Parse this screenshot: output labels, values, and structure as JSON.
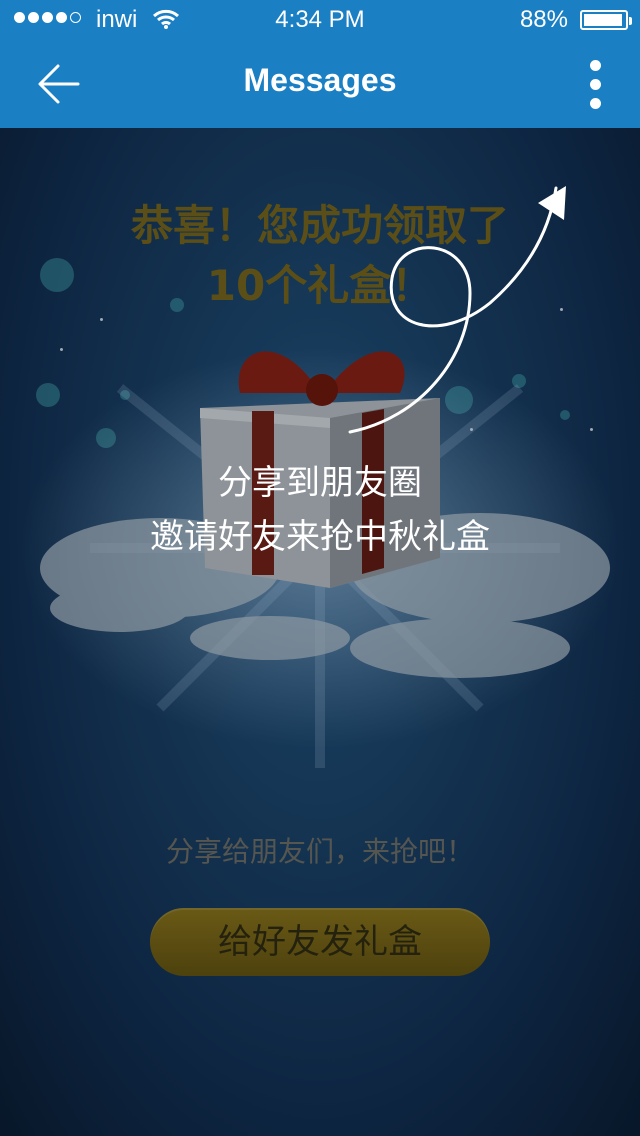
{
  "status_bar": {
    "carrier": "inwi",
    "time": "4:34 PM",
    "battery_percent": "88%",
    "battery_level": 0.88,
    "signal_bars_filled": 4,
    "signal_bars_total": 5
  },
  "nav": {
    "title": "Messages",
    "back_icon": "back-arrow-icon",
    "more_icon": "more-vertical-icon"
  },
  "main": {
    "congrats_line1": "恭喜！您成功领取了",
    "congrats_line2": "10个礼盒！",
    "overlay_line1": "分享到朋友圈",
    "overlay_line2": "邀请好友来抢中秋礼盒",
    "share_hint": "分享给朋友们，来抢吧！",
    "send_button_label": "给好友发礼盒"
  },
  "colors": {
    "nav_bar": "#1b7fc4",
    "button": "#6a5a16",
    "congrats_text": "#5b4f17"
  }
}
